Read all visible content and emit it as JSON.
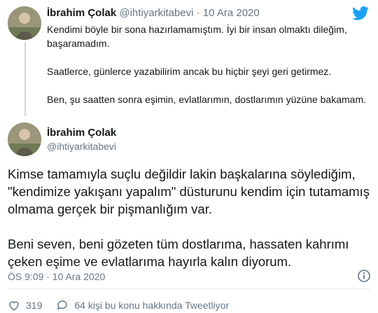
{
  "tweet1": {
    "author_name": "İbrahim Çolak",
    "author_handle": "@ihtiyarkitabevi",
    "separator": "·",
    "date": "10 Ara 2020",
    "paragraphs": [
      "Kendimi böyle bir sona hazırlamamıştım. İyi bir insan olmaktı dileğim, başaramadım.",
      "Saatlerce, günlerce yazabilirim ancak bu hiçbir şeyi geri getirmez.",
      "Ben, şu saatten sonra eşimin, evlatlarımın, dostlarımın yüzüne bakamam."
    ]
  },
  "tweet2": {
    "author_name": "İbrahim Çolak",
    "author_handle": "@ihtiyarkitabevi",
    "paragraphs": [
      "Kimse tamamıyla suçlu değildir lakin başkalarına söylediğim,  \"kendimize yakışanı yapalım\" düsturunu kendim için tutamamış olmama gerçek bir pişmanlığım var.",
      "Beni seven, beni gözeten tüm dostlarıma, hassaten kahrımı çeken eşime ve evlatlarıma hayırla kalın diyorum."
    ],
    "timestamp": "ÖS 9:09 · 10 Ara 2020"
  },
  "footer": {
    "likes": "319",
    "discussion": "64 kişi bu konu hakkında Tweetliyor"
  },
  "colors": {
    "twitter_blue": "#1da1f2",
    "muted": "#657786",
    "like_red": "#e0245e"
  },
  "icons": {
    "brand": "twitter-bird-icon",
    "info": "info-icon",
    "like": "heart-icon",
    "reply": "speech-bubble-icon"
  }
}
